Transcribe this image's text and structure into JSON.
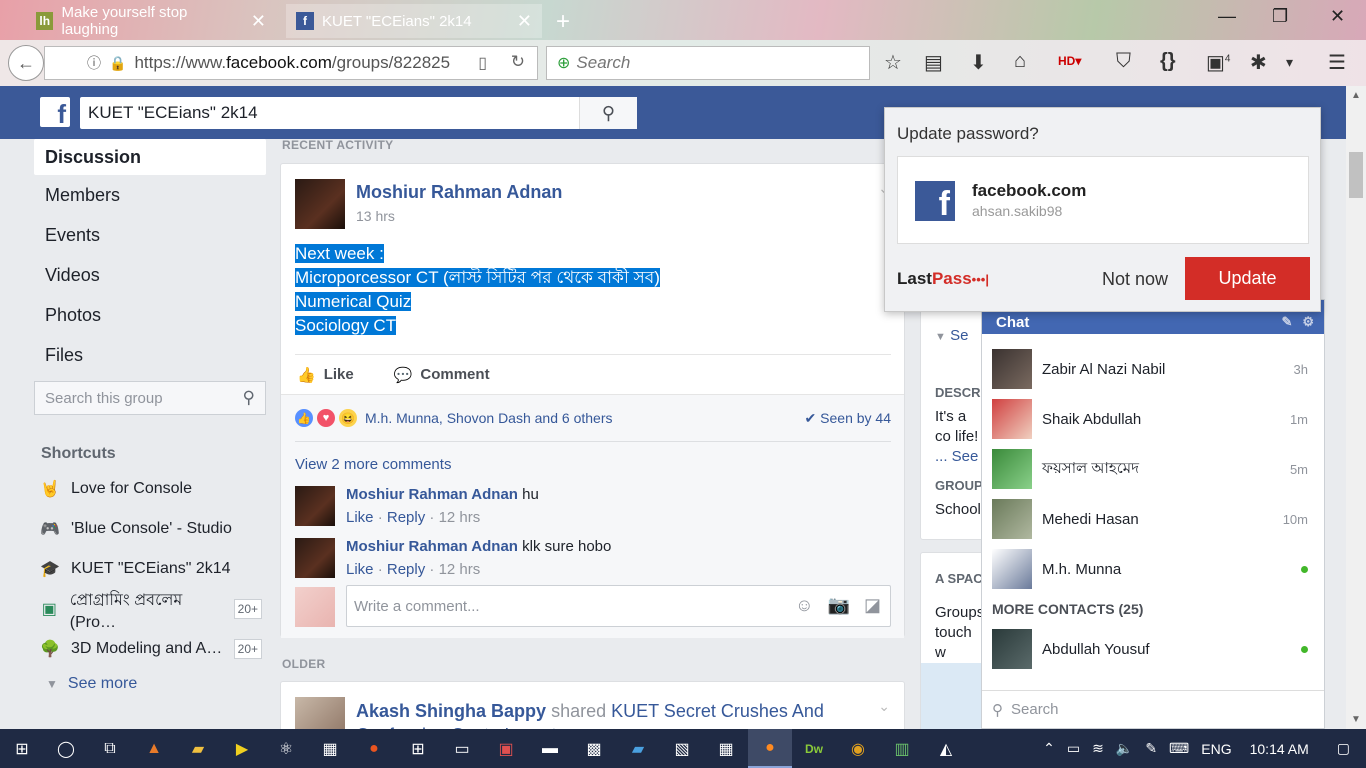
{
  "browser": {
    "tabs": [
      {
        "title": "Make yourself stop laughing",
        "icon": "lh"
      },
      {
        "title": "KUET \"ECEians\" 2k14",
        "icon": "f"
      }
    ],
    "url_prefix": "https://www.",
    "url_domain": "facebook.com",
    "url_path": "/groups/822825",
    "search_placeholder": "Search",
    "addon_badge": "4"
  },
  "fb": {
    "search_value": "KUET \"ECEians\" 2k14",
    "nav": [
      "Discussion",
      "Members",
      "Events",
      "Videos",
      "Photos",
      "Files"
    ],
    "group_search_placeholder": "Search this group",
    "shortcuts_title": "Shortcuts",
    "shortcuts": [
      {
        "label": "Love for Console",
        "icon": "rock-hand-icon",
        "count": ""
      },
      {
        "label": "'Blue Console' - Studio",
        "icon": "gamepad-icon",
        "count": ""
      },
      {
        "label": "KUET \"ECEians\" 2k14",
        "icon": "graduation-cap-icon",
        "count": ""
      },
      {
        "label": "প্রোগ্রামিং প্রবলেম (Pro…",
        "icon": "screen-icon",
        "count": "20+"
      },
      {
        "label": "3D Modeling and A…",
        "icon": "tree-icon",
        "count": "20+"
      }
    ],
    "see_more": "See more"
  },
  "feed": {
    "recent_label": "RECENT ACTIVITY",
    "older_label": "OLDER",
    "post": {
      "author": "Moshiur Rahman Adnan",
      "time": "13 hrs",
      "lines": [
        "Next week :",
        "Microporcessor CT (লাস্ট সিটির পর থেকে বাকী সব)",
        "Numerical Quiz",
        "Sociology CT"
      ],
      "like": "Like",
      "comment": "Comment",
      "reactors": "M.h. Munna, Shovon Dash and 6 others",
      "seen": "Seen by 44",
      "view_more": "View 2 more comments",
      "comments": [
        {
          "author": "Moshiur Rahman Adnan",
          "text": "hu",
          "like": "Like",
          "reply": "Reply",
          "time": "12 hrs"
        },
        {
          "author": "Moshiur Rahman Adnan",
          "text": "klk sure hobo",
          "like": "Like",
          "reply": "Reply",
          "time": "12 hrs"
        }
      ],
      "write_placeholder": "Write a comment..."
    },
    "post2": {
      "author": "Akash Shingha Bappy",
      "action": "shared",
      "target": "KUET Secret Crushes And Confession Centre's post."
    }
  },
  "right": {
    "see": "Se",
    "desc_label": "DESCR",
    "desc_text": "It's a co life!",
    "desc_see": "... See",
    "group_label": "GROUP",
    "group_text": "School",
    "space_label": "A SPAC",
    "space_text": "Groups touch w"
  },
  "chat": {
    "title": "Chat",
    "contacts": [
      {
        "name": "Zabir Al Nazi Nabil",
        "time": "3h",
        "online": false
      },
      {
        "name": "Shaik Abdullah",
        "time": "1m",
        "online": false
      },
      {
        "name": "ফয়সাল আহমেদ",
        "time": "5m",
        "online": false
      },
      {
        "name": "Mehedi Hasan",
        "time": "10m",
        "online": false
      },
      {
        "name": "M.h. Munna",
        "time": "",
        "online": true
      }
    ],
    "more_contacts": "MORE CONTACTS (25)",
    "more": [
      {
        "name": "Abdullah Yousuf",
        "online": true
      }
    ],
    "search_placeholder": "Search"
  },
  "lastpass": {
    "title": "Update password?",
    "site": "facebook.com",
    "user": "ahsan.sakib98",
    "logo_a": "Last",
    "logo_b": "Pass",
    "not_now": "Not now",
    "update": "Update"
  },
  "taskbar": {
    "lang": "ENG",
    "time": "10:14 AM"
  },
  "colors": {
    "fb_blue": "#3b5998",
    "link": "#365899",
    "lastpass_red": "#d32d27",
    "selection": "#0078d7"
  }
}
